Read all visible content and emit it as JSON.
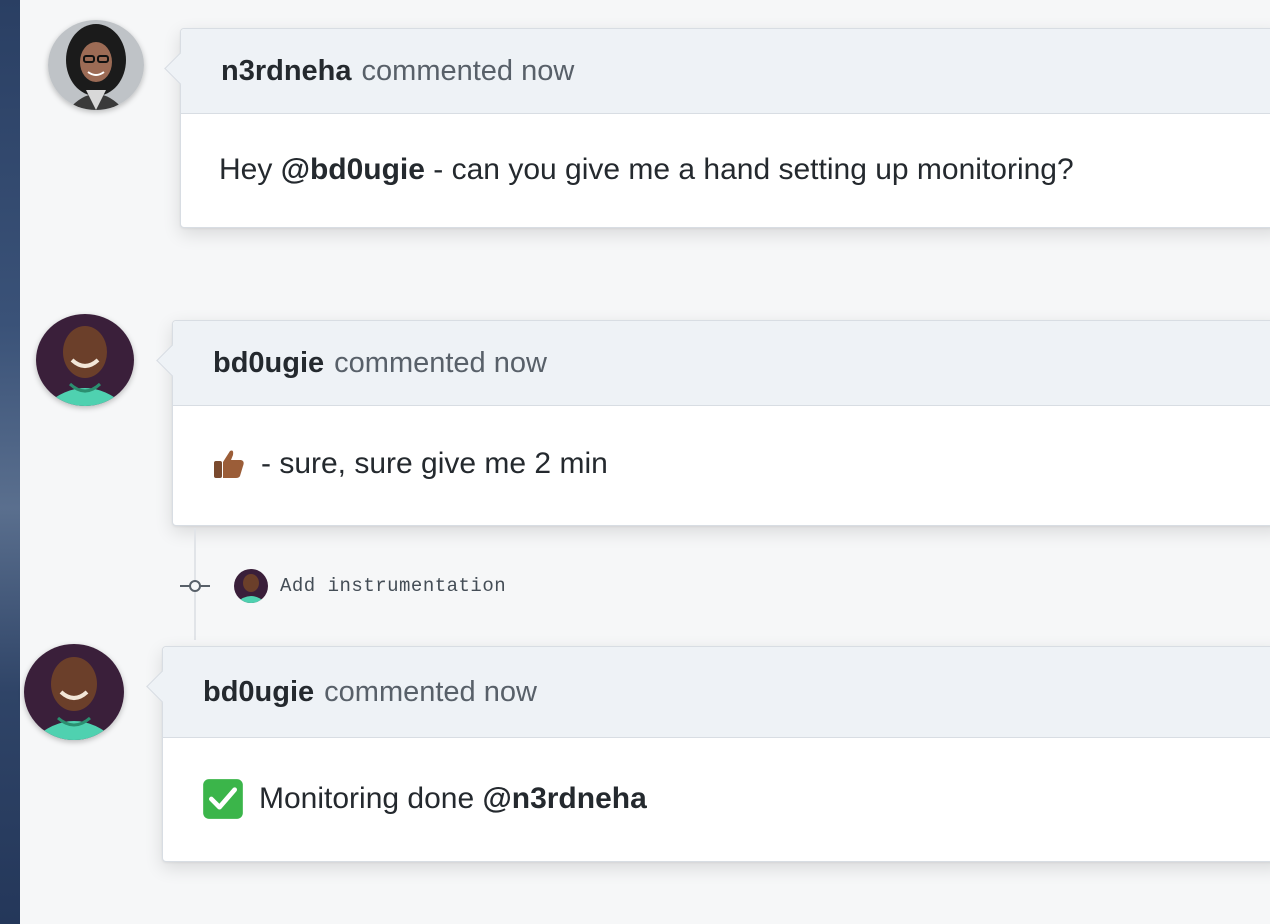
{
  "comments": [
    {
      "author": "n3rdneha",
      "meta": "commented now",
      "body_prefix": "Hey ",
      "mention": "@bd0ugie",
      "body_suffix": " - can you give me a hand setting up monitoring?"
    },
    {
      "author": "bd0ugie",
      "meta": "commented now",
      "body_text": "- sure, sure give me 2 min",
      "emoji": "thumbs-up"
    },
    {
      "author": "bd0ugie",
      "meta": "commented now",
      "body_text": "Monitoring done ",
      "mention": "@n3rdneha",
      "emoji": "check-mark"
    }
  ],
  "commit": {
    "message": "Add instrumentation"
  },
  "colors": {
    "header_bg": "#eef2f6",
    "border": "#d8dde3",
    "text": "#24292e",
    "muted": "#586069",
    "check_green": "#3bb54a"
  }
}
